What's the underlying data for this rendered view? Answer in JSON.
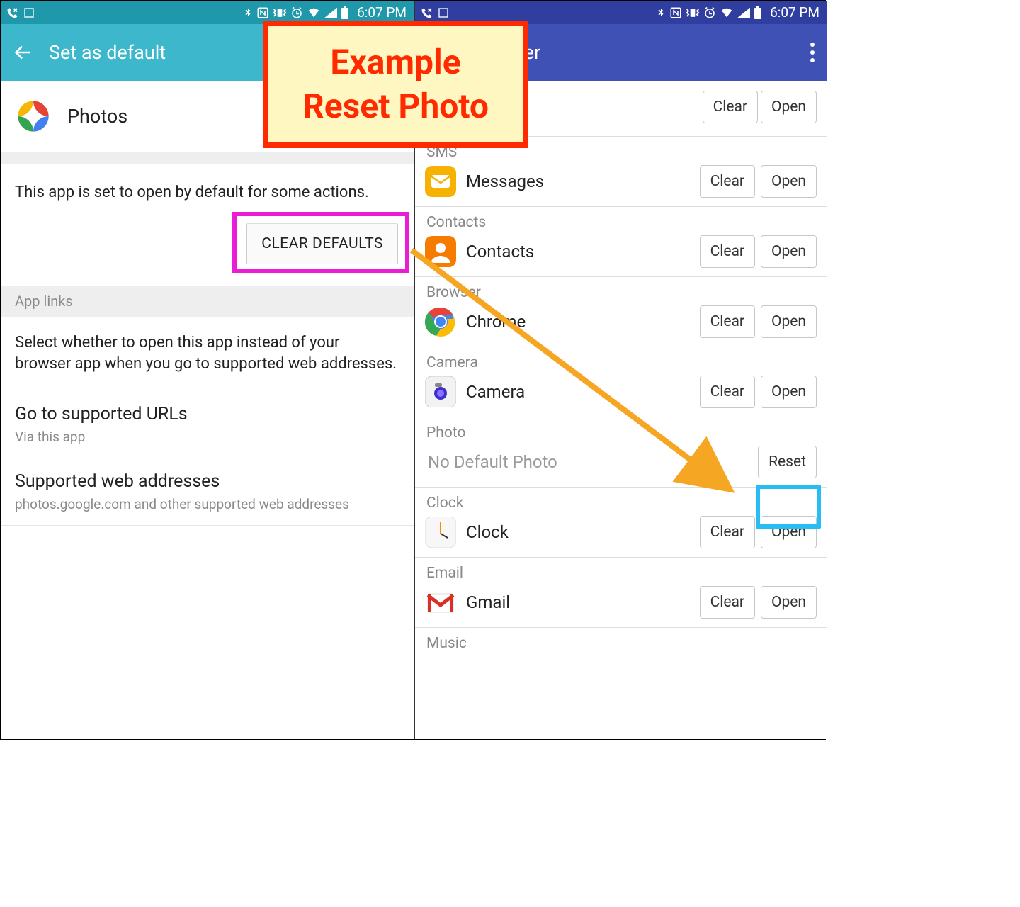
{
  "status": {
    "time": "6:07 PM"
  },
  "callout": {
    "line1": "Example",
    "line2": "Reset Photo"
  },
  "left": {
    "appbar_title": "Set as default",
    "app_name": "Photos",
    "default_text": "This app is set to open by default for some actions.",
    "clear_defaults": "CLEAR DEFAULTS",
    "app_links_header": "App links",
    "app_links_desc": "Select whether to open this app instead of your browser app when you go to supported web addresses.",
    "supported_urls": {
      "title": "Go to supported URLs",
      "subtitle": "Via this app"
    },
    "supported_web": {
      "title": "Supported web addresses",
      "subtitle": "photos.google.com and other supported web addresses"
    }
  },
  "right": {
    "appbar_title": "App Manager",
    "buttons": {
      "clear": "Clear",
      "open": "Open",
      "reset": "Reset"
    },
    "rows": [
      {
        "category": "SMS",
        "app": "Messages",
        "icon": "messages"
      },
      {
        "category": "Contacts",
        "app": "Contacts",
        "icon": "contacts"
      },
      {
        "category": "Browser",
        "app": "Chrome",
        "icon": "chrome"
      },
      {
        "category": "Camera",
        "app": "Camera",
        "icon": "camera"
      }
    ],
    "photo": {
      "category": "Photo",
      "text": "No Default Photo"
    },
    "rows2": [
      {
        "category": "Clock",
        "app": "Clock",
        "icon": "clock"
      },
      {
        "category": "Email",
        "app": "Gmail",
        "icon": "gmail"
      }
    ],
    "music_category": "Music"
  }
}
